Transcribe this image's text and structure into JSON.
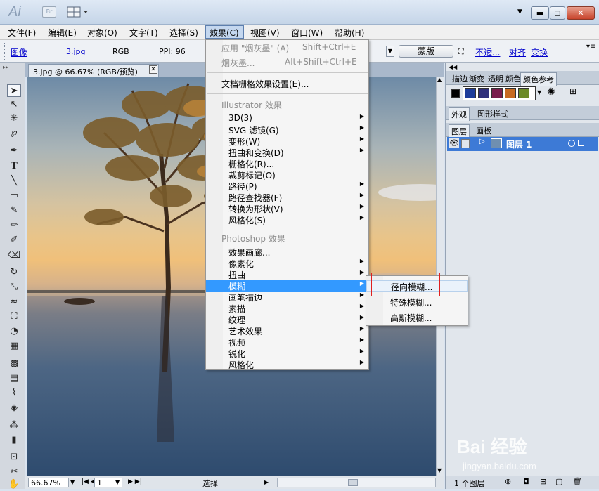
{
  "app": {
    "logo": "Ai",
    "bridge_badge": "Br",
    "window_controls": [
      "minimize",
      "restore",
      "close"
    ]
  },
  "menubar": {
    "items": [
      "文件(F)",
      "编辑(E)",
      "对象(O)",
      "文字(T)",
      "选择(S)",
      "效果(C)",
      "视图(V)",
      "窗口(W)",
      "帮助(H)"
    ]
  },
  "controlbar": {
    "image_label": "图像",
    "file_name": "3.jpg",
    "color_mode": "RGB",
    "ppi": "PPI: 96",
    "mask_button": "蒙版",
    "opacity_link": "不透...",
    "align_link": "对齐",
    "transform_link": "变换"
  },
  "document": {
    "tab_title": "3.jpg @ 66.67% (RGB/预览)"
  },
  "statusbar": {
    "zoom": "66.67%",
    "page": "1",
    "tool": "选择"
  },
  "panels": {
    "top_tabs": [
      "描边",
      "渐变",
      "透明",
      "颜色",
      "颜色参考"
    ],
    "appearance_tabs": [
      "外观",
      "图形样式"
    ],
    "layer_tabs": [
      "图层",
      "画板"
    ],
    "layer_name": "图层 1",
    "layer_count": "1 个图层",
    "swatch_colors": [
      "#1c3c9a",
      "#2f2f7a",
      "#7a1c4c",
      "#c86a20",
      "#6b8a28"
    ]
  },
  "effects_menu": {
    "apply_last": {
      "label": "应用 \"烟灰墨\" (A)",
      "shortcut": "Shift+Ctrl+E"
    },
    "last_effect": {
      "label": "烟灰墨...",
      "shortcut": "Alt+Shift+Ctrl+E"
    },
    "raster_settings": "文档栅格效果设置(E)...",
    "illustrator_header": "Illustrator 效果",
    "illustrator_items": [
      {
        "label": "3D(3)",
        "submenu": true
      },
      {
        "label": "SVG 滤镜(G)",
        "submenu": true
      },
      {
        "label": "变形(W)",
        "submenu": true
      },
      {
        "label": "扭曲和变换(D)",
        "submenu": true
      },
      {
        "label": "栅格化(R)...",
        "submenu": false
      },
      {
        "label": "裁剪标记(O)",
        "submenu": false
      },
      {
        "label": "路径(P)",
        "submenu": true
      },
      {
        "label": "路径查找器(F)",
        "submenu": true
      },
      {
        "label": "转换为形状(V)",
        "submenu": true
      },
      {
        "label": "风格化(S)",
        "submenu": true
      }
    ],
    "photoshop_header": "Photoshop 效果",
    "photoshop_items": [
      {
        "label": "效果画廊...",
        "submenu": false
      },
      {
        "label": "像素化",
        "submenu": true
      },
      {
        "label": "扭曲",
        "submenu": true
      },
      {
        "label": "模糊",
        "submenu": true
      },
      {
        "label": "画笔描边",
        "submenu": true
      },
      {
        "label": "素描",
        "submenu": true
      },
      {
        "label": "纹理",
        "submenu": true
      },
      {
        "label": "艺术效果",
        "submenu": true
      },
      {
        "label": "视频",
        "submenu": true
      },
      {
        "label": "锐化",
        "submenu": true
      },
      {
        "label": "风格化",
        "submenu": true
      }
    ]
  },
  "blur_submenu": {
    "items": [
      "径向模糊...",
      "特殊模糊...",
      "高斯模糊..."
    ]
  },
  "watermark": {
    "brand": "Bai 经验",
    "url": "jingyan.baidu.com"
  },
  "colors": {
    "highlight": "#3399ff",
    "annotation_box": "#e02020"
  }
}
